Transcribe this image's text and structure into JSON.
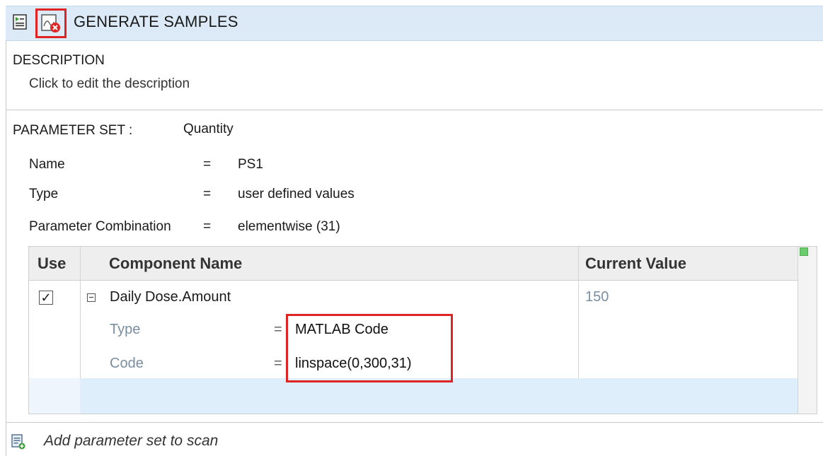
{
  "header": {
    "title": "GENERATE SAMPLES",
    "icons": [
      "program-icon",
      "delete-step-icon"
    ]
  },
  "description": {
    "label": "DESCRIPTION",
    "text": "Click to edit the description"
  },
  "parameter_set": {
    "label": "PARAMETER SET :",
    "value": "Quantity",
    "fields": [
      {
        "label": "Name",
        "eq": "=",
        "value": "PS1"
      },
      {
        "label": "Type",
        "eq": "=",
        "value": "user defined values"
      },
      {
        "label": "Parameter Combination",
        "eq": "=",
        "value": "elementwise (31)"
      }
    ]
  },
  "table": {
    "columns": [
      "Use",
      "Component Name",
      "Current Value"
    ],
    "rows": [
      {
        "use_checked": "✓",
        "component": "Daily Dose.Amount",
        "current_value": "150",
        "sub": [
          {
            "label": "Type",
            "eq": "=",
            "value": "MATLAB Code"
          },
          {
            "label": "Code",
            "eq": "=",
            "value": "linspace(0,300,31)"
          }
        ]
      }
    ],
    "status_color": "#6dcc6d"
  },
  "footer": {
    "add_label": "Add parameter set to scan"
  },
  "colors": {
    "header_bg": "#dceaf7",
    "highlight": "#e02424",
    "selected_row": "#dfeefb"
  }
}
